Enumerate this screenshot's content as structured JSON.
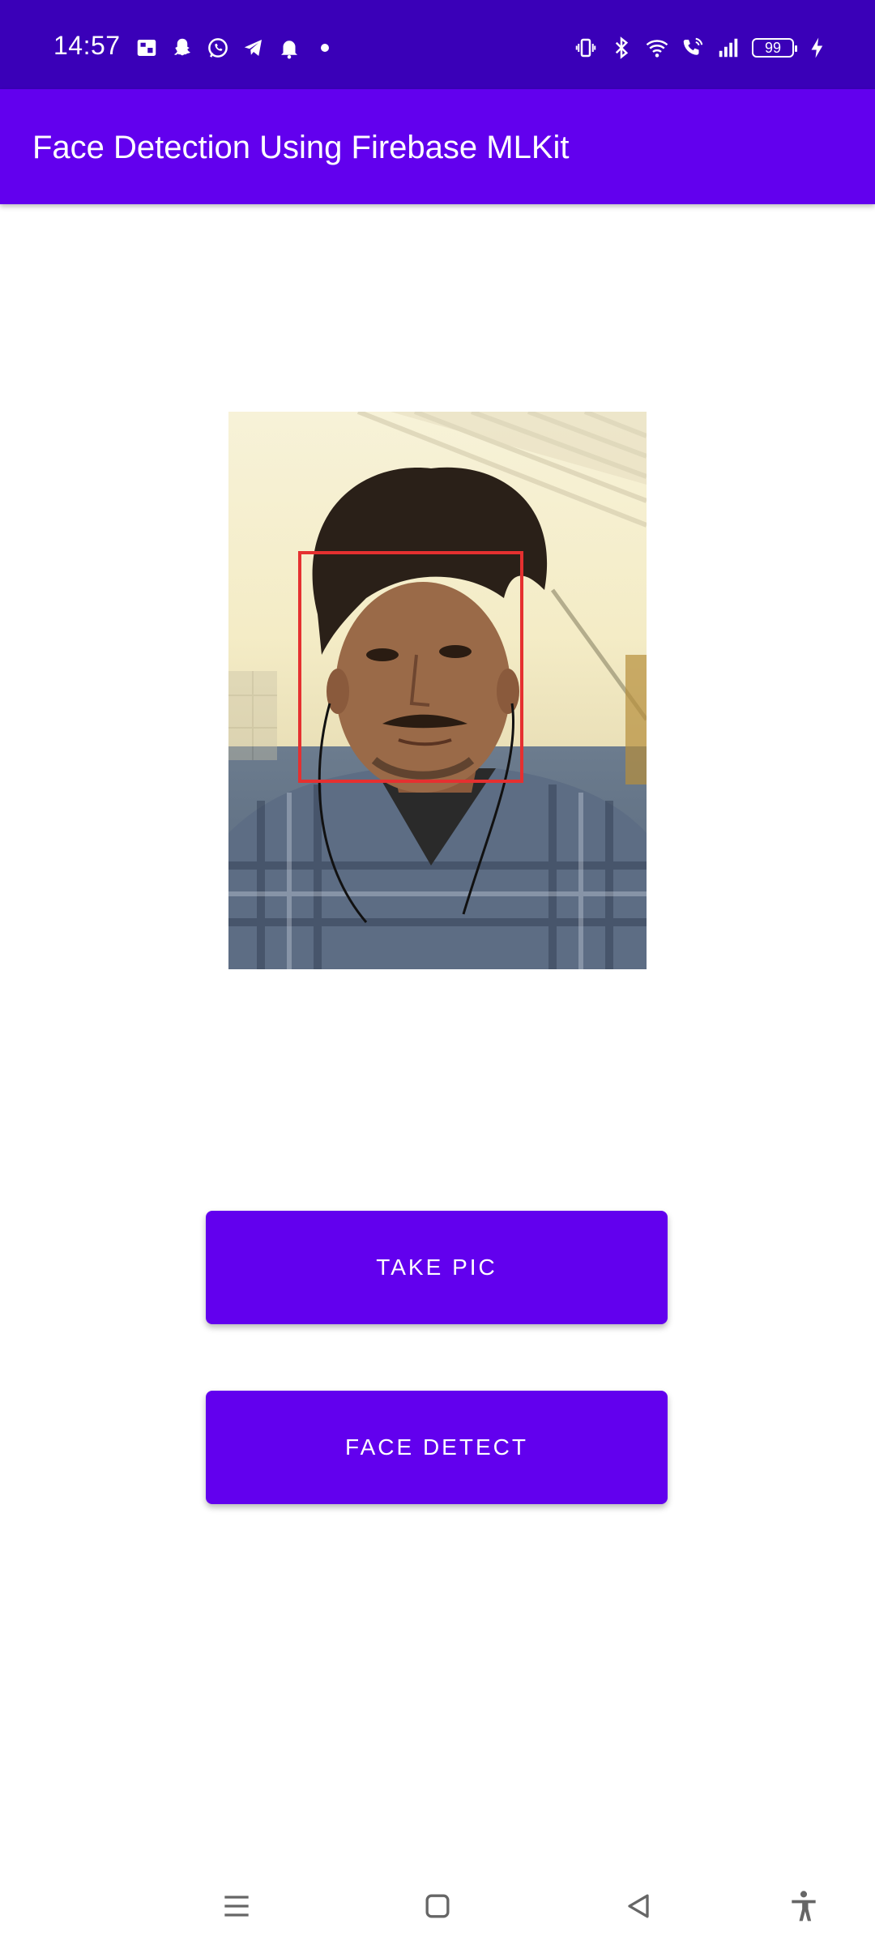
{
  "status_bar": {
    "time": "14:57",
    "battery_level": "99",
    "notification_icons": [
      "gallery-icon",
      "snapchat-icon",
      "whatsapp-icon",
      "telegram-icon",
      "bell-icon",
      "dot-icon"
    ],
    "system_icons": [
      "vibrate-icon",
      "bluetooth-icon",
      "wifi-icon",
      "wifi-calling-icon",
      "signal-icon",
      "battery-icon",
      "charging-icon"
    ]
  },
  "app_bar": {
    "title": "Face Detection Using Firebase MLKit"
  },
  "colors": {
    "status_bar": "#3a00b8",
    "primary": "#6200ee",
    "face_box": "#e53030"
  },
  "buttons": {
    "take_pic": "TAKE PIC",
    "face_detect": "FACE DETECT"
  },
  "nav_bar": {
    "icons": [
      "menu-icon",
      "home-icon",
      "back-icon",
      "accessibility-icon"
    ]
  }
}
